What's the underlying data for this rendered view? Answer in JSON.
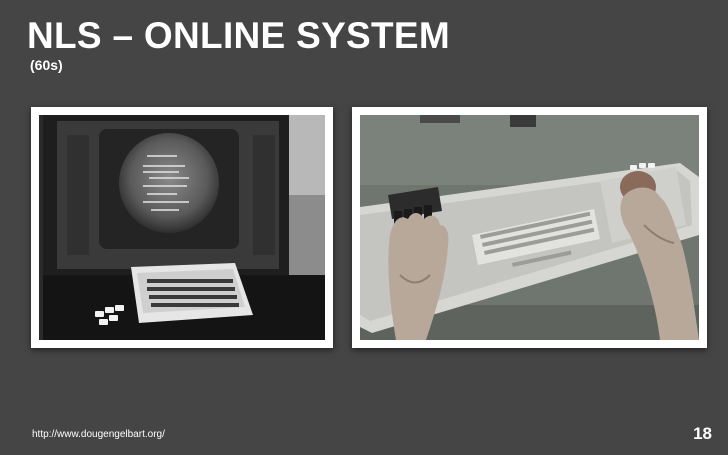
{
  "slide": {
    "title": "NLS – ONLINE SYSTEM",
    "subtitle": "(60s)",
    "footer_url": "http://www.dougengelbart.org/",
    "slide_number": "18"
  },
  "photos": {
    "left": {
      "subject": "NLS workstation with round CRT display, keyboard and chord keyset"
    },
    "right": {
      "subject": "hands operating chord keyset, keyboard and mouse"
    }
  },
  "colors": {
    "background": "#454545",
    "text": "#ffffff",
    "frame": "#ffffff"
  }
}
